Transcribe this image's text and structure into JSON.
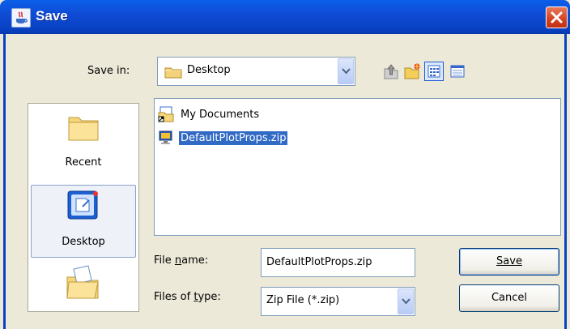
{
  "window": {
    "title": "Save",
    "close_icon": "close-icon"
  },
  "toolbar": {
    "save_in_label": "Save in:",
    "location_value": "Desktop",
    "icons": [
      "up-folder-icon",
      "new-folder-icon",
      "list-view-icon",
      "details-view-icon"
    ]
  },
  "places": [
    {
      "label": "Recent",
      "icon": "recent-folder-icon",
      "selected": false
    },
    {
      "label": "Desktop",
      "icon": "desktop-icon",
      "selected": true
    },
    {
      "label": "",
      "icon": "my-documents-icon",
      "selected": false
    }
  ],
  "files": [
    {
      "name": "My Documents",
      "icon": "my-documents-shortcut-icon",
      "selected": false
    },
    {
      "name": "DefaultPlotProps.zip",
      "icon": "zip-file-icon",
      "selected": true
    }
  ],
  "form": {
    "file_name_label": "File name:",
    "file_name_value": "DefaultPlotProps.zip",
    "file_type_label": "Files of type:",
    "file_type_value": "Zip File (*.zip)"
  },
  "buttons": {
    "save": "Save",
    "cancel": "Cancel"
  },
  "colors": {
    "titlebar": "#0A5FE8",
    "selection": "#316AC5",
    "dialog_bg": "#ECE9D8",
    "close": "#D6401F"
  }
}
